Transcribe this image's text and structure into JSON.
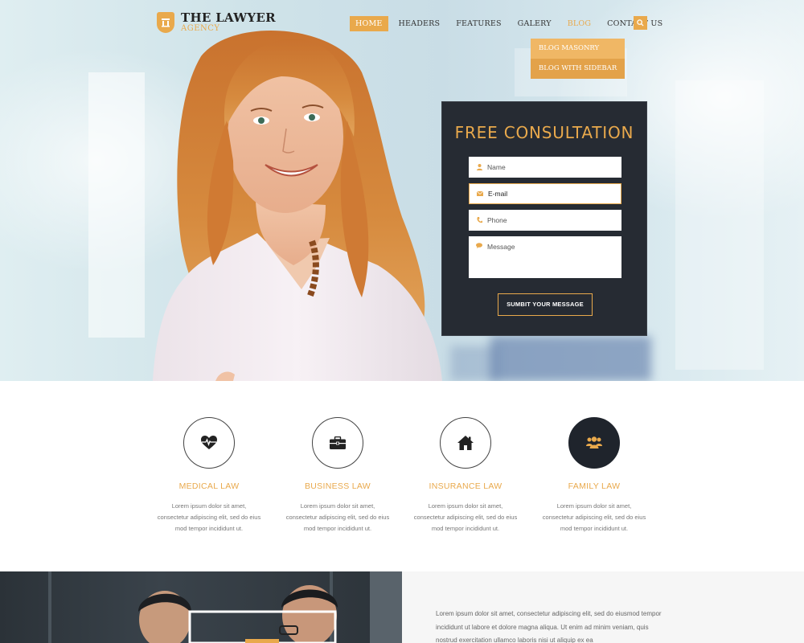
{
  "brand": {
    "name": "THE LAWYER",
    "tagline": "AGENCY",
    "accent_color": "#e9a94c",
    "dark_color": "#262b33"
  },
  "nav": {
    "items": [
      {
        "label": "HOME",
        "active": true
      },
      {
        "label": "HEADERS"
      },
      {
        "label": "FEATURES"
      },
      {
        "label": "GALERY"
      },
      {
        "label": "BLOG",
        "highlight": true
      },
      {
        "label": "CONTACT US"
      }
    ],
    "search_icon": "search-icon",
    "dropdown": [
      "BLOG MASONRY",
      "BLOG WITH SIDEBAR"
    ]
  },
  "consultation": {
    "title": "FREE CONSULTATION",
    "fields": {
      "name_placeholder": "Name",
      "email_value": "E-mail",
      "phone_placeholder": "Phone",
      "message_placeholder": "Message"
    },
    "submit_label": "SUMBIT YOUR MESSAGE"
  },
  "services": [
    {
      "title": "MEDICAL LAW",
      "icon": "heartbeat-icon",
      "text": "Lorem ipsum dolor sit amet, consectetur adipiscing elit, sed do eius mod tempor incididunt ut."
    },
    {
      "title": "BUSINESS LAW",
      "icon": "briefcase-icon",
      "text": "Lorem ipsum dolor sit amet, consectetur adipiscing elit, sed do eius mod tempor incididunt ut."
    },
    {
      "title": "INSURANCE LAW",
      "icon": "home-icon",
      "text": "Lorem ipsum dolor sit amet, consectetur adipiscing elit, sed do eius mod tempor incididunt ut."
    },
    {
      "title": "FAMILY LAW",
      "icon": "users-icon",
      "text": "Lorem ipsum dolor sit amet, consectetur adipiscing elit, sed do eius mod tempor incididunt ut."
    }
  ],
  "about": {
    "text": "Lorem ipsum dolor sit amet, consectetur adipiscing elit, sed do eiusmod tempor incididunt ut labore et dolore magna aliqua. Ut enim ad minim veniam, quis nostrud exercitation ullamco laboris nisi ut aliquip ex ea"
  }
}
